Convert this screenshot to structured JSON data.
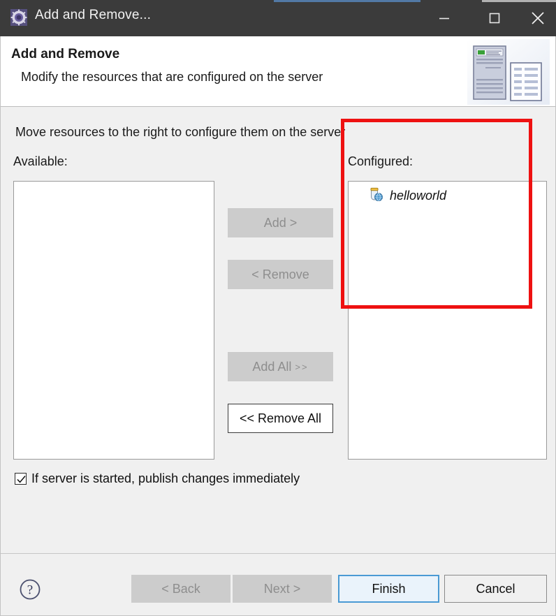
{
  "window": {
    "title": "Add and Remove...",
    "icon": "eclipse-wizard-icon",
    "controls": {
      "minimize": "minimize-icon",
      "maximize": "maximize-icon",
      "close": "close-icon"
    }
  },
  "header": {
    "title": "Add and Remove",
    "description": "Modify the resources that are configured on the server",
    "artwork": "server-and-document-icon"
  },
  "content": {
    "instruction": "Move resources to the right to configure them on the server",
    "available": {
      "label": "Available:",
      "items": []
    },
    "configured": {
      "label": "Configured:",
      "items": [
        {
          "name": "helloworld",
          "icon": "web-module-icon",
          "italic": true
        }
      ]
    },
    "transfer_buttons": [
      {
        "label": "Add >",
        "enabled": false
      },
      {
        "label": "< Remove",
        "enabled": false
      },
      {
        "label": "Add All",
        "suffix": ">>",
        "enabled": false
      },
      {
        "label": "<< Remove All",
        "enabled": true
      }
    ],
    "publish_option": {
      "label": "If server is started, publish changes immediately",
      "checked": true
    }
  },
  "annotation": {
    "type": "highlight-rectangle",
    "color": "#ee1111"
  },
  "footer": {
    "help": "help-icon",
    "buttons": [
      {
        "label": "< Back",
        "state": "disabled"
      },
      {
        "label": "Next >",
        "state": "disabled"
      },
      {
        "label": "Finish",
        "state": "default"
      },
      {
        "label": "Cancel",
        "state": "normal"
      }
    ]
  },
  "colors": {
    "titlebar": "#3b3b3b",
    "accent": "#5b8fc9",
    "dialog_bg": "#f0f0f0",
    "default_button_border": "#4a9ad4",
    "annotation": "#ee1111"
  }
}
